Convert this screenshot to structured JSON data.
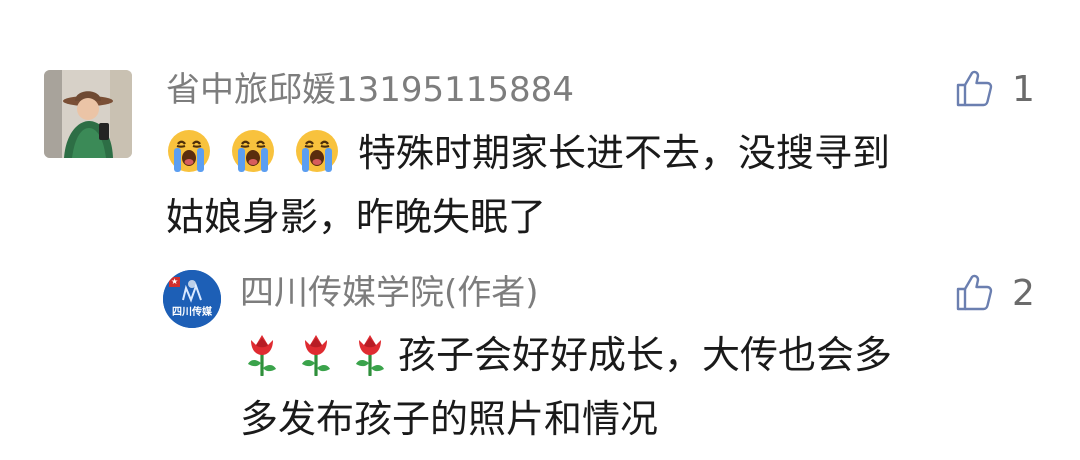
{
  "comments": [
    {
      "nickname": "省中旅邱媛13195115884",
      "emoji_prefix": [
        "crying-face",
        "crying-face",
        "crying-face"
      ],
      "text_line1": "特殊时期家长进不去，没搜寻到",
      "text_line2": "姑娘身影，昨晚失眠了",
      "likes": "1"
    },
    {
      "nickname": "四川传媒学院(作者)",
      "avatar_text": "四川传媒",
      "emoji_prefix": [
        "rose",
        "rose",
        "rose"
      ],
      "text_line1": "孩子会好好成长，大传也会多",
      "text_line2": "多发布孩子的照片和情况",
      "likes": "2"
    }
  ],
  "icons": {
    "like": "thumbs-up-icon"
  },
  "colors": {
    "nickname": "#7d7d7d",
    "comment_text": "#1a1a1a",
    "like_icon": "#6b7fb0",
    "author_logo": "#1d5fb6"
  }
}
